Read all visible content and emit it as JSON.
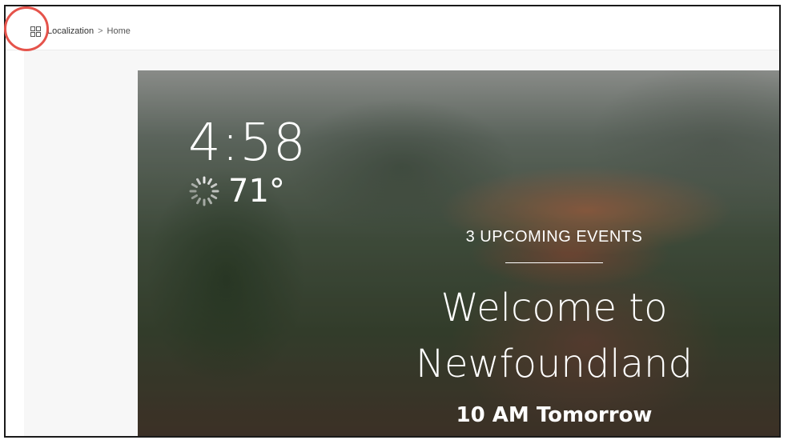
{
  "breadcrumb": {
    "app_icon": "grid-icon",
    "section": "Localization",
    "separator": ">",
    "current": "Home"
  },
  "hero": {
    "time": "4:58",
    "weather_icon": "loading-spinner-icon",
    "temperature": "71°",
    "upcoming_events": "3 UPCOMING EVENTS",
    "event_title_line1": "Welcome to",
    "event_title_line2": "Newfoundland",
    "event_time": "10 AM Tomorrow"
  },
  "colors": {
    "highlight_ring": "#e5534b",
    "text_on_hero": "#ffffff"
  }
}
